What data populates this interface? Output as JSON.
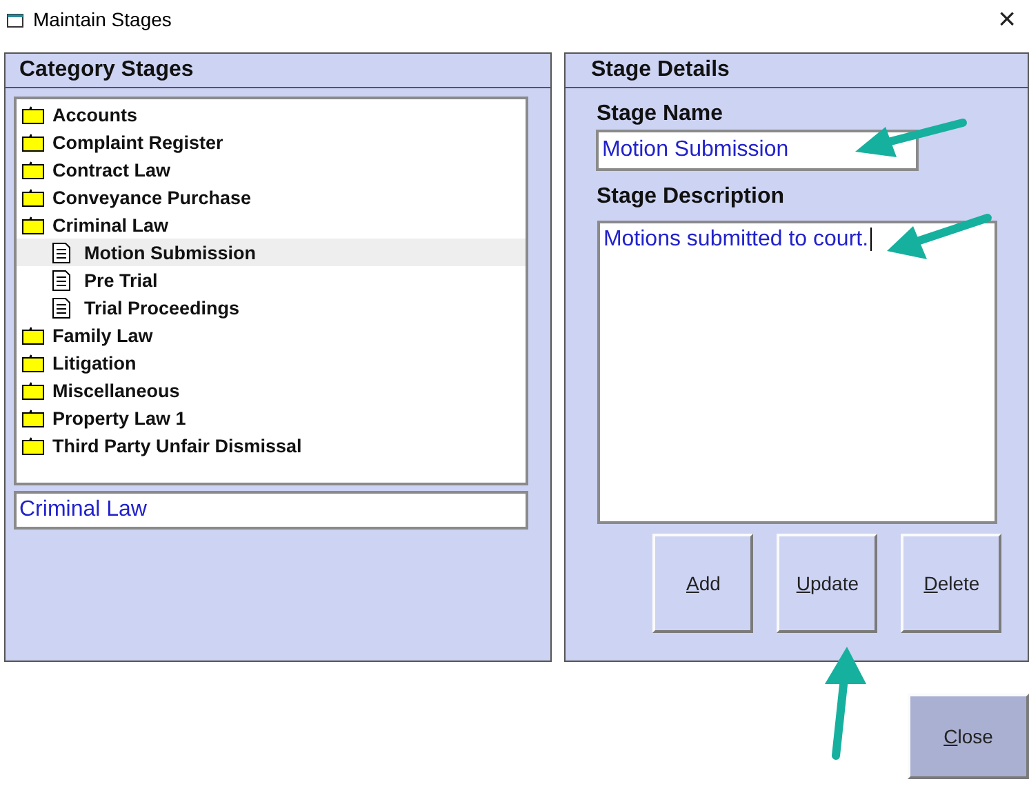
{
  "window": {
    "title": "Maintain Stages",
    "close": "×"
  },
  "category_panel": {
    "title": "Category Stages",
    "tree": [
      {
        "kind": "folder",
        "label": "Accounts",
        "selected": false
      },
      {
        "kind": "folder",
        "label": "Complaint Register",
        "selected": false
      },
      {
        "kind": "folder",
        "label": "Contract Law",
        "selected": false
      },
      {
        "kind": "folder",
        "label": "Conveyance Purchase",
        "selected": false
      },
      {
        "kind": "folder",
        "label": "Criminal Law",
        "selected": false,
        "children": [
          {
            "kind": "stage",
            "label": "Motion Submission",
            "selected": true
          },
          {
            "kind": "stage",
            "label": "Pre Trial",
            "selected": false
          },
          {
            "kind": "stage",
            "label": "Trial Proceedings",
            "selected": false
          }
        ]
      },
      {
        "kind": "folder",
        "label": "Family Law",
        "selected": false
      },
      {
        "kind": "folder",
        "label": "Litigation",
        "selected": false
      },
      {
        "kind": "folder",
        "label": "Miscellaneous",
        "selected": false
      },
      {
        "kind": "folder",
        "label": "Property Law 1",
        "selected": false
      },
      {
        "kind": "folder",
        "label": "Third Party Unfair Dismissal",
        "selected": false
      }
    ],
    "category_field": {
      "value": "Criminal Law"
    }
  },
  "details_panel": {
    "title": "Stage Details",
    "name_label": "Stage Name",
    "name_value": "Motion Submission",
    "description_label": "Stage Description",
    "description_value": "Motions submitted to court.",
    "buttons": [
      {
        "label": "Add",
        "underline_first": true
      },
      {
        "label": "Update",
        "underline_first": true
      },
      {
        "label": "Delete",
        "underline_first": true
      }
    ]
  },
  "close_button": {
    "label": "Close",
    "underline_first": true
  }
}
